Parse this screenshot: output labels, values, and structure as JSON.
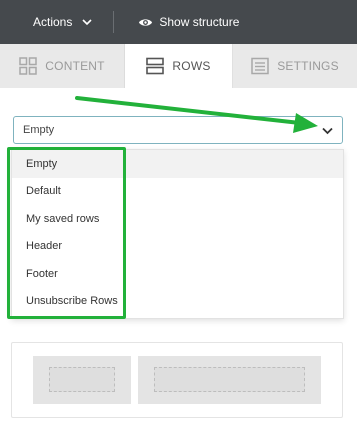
{
  "topbar": {
    "actions_label": "Actions",
    "show_structure_label": "Show structure"
  },
  "tabs": [
    {
      "label": "CONTENT",
      "icon": "grid-icon",
      "active": false
    },
    {
      "label": "ROWS",
      "icon": "rows-icon",
      "active": true
    },
    {
      "label": "SETTINGS",
      "icon": "settings-panel-icon",
      "active": false
    }
  ],
  "row_select": {
    "value": "Empty",
    "options": [
      "Empty",
      "Default",
      "My saved rows",
      "Header",
      "Footer",
      "Unsubscribe Rows"
    ],
    "selected_index": 0
  },
  "colors": {
    "topbar": "#45494d",
    "annotation_green": "#22b13a",
    "select_border": "#7fb3bf"
  }
}
